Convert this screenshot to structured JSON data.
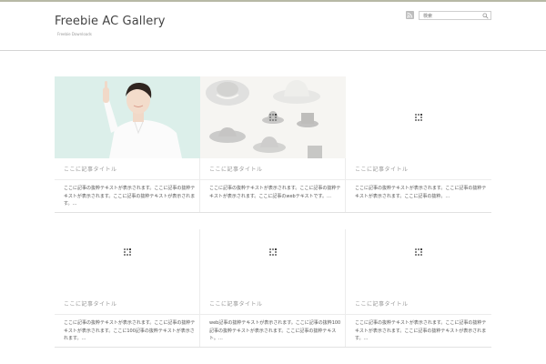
{
  "site": {
    "title": "Freebie AC Gallery",
    "tagline": "Freebie Downloads"
  },
  "search": {
    "placeholder": "検索"
  },
  "icons": {
    "rss": "rss-icon",
    "search": "search-icon",
    "loading": "loading-icon"
  },
  "colors": {
    "nurse_bg": "#cfe7e2",
    "hats_bg": "#f1f0eb",
    "title_gray": "#999999"
  },
  "posts": [
    {
      "title": "ここに記事タイトル",
      "excerpt": "ここに記事の抜粋テキストが表示されます。ここに記事の抜粋テキストが表示されます。ここに記事の抜粋テキストが表示されます。…"
    },
    {
      "title": "ここに記事タイトル",
      "excerpt": "ここに記事の抜粋テキストが表示されます。ここに記事の抜粋テキストが表示されます。ここに記事のwebテキストです。…"
    },
    {
      "title": "ここに記事タイトル",
      "excerpt": "ここに記事の抜粋テキストが表示されます。ここに記事の抜粋テキストが表示されます。ここに記事の抜粋。…"
    },
    {
      "title": "ここに記事タイトル",
      "excerpt": "ここに記事の抜粋テキストが表示されます。ここに記事の抜粋テキストが表示されます。ここに100記事の抜粋テキストが表示されます。…"
    },
    {
      "title": "ここに記事タイトル",
      "excerpt": "web記事の抜粋テキストが表示されます。ここに記事の抜粋100記事の抜粋テキストが表示されます。ここに記事の抜粋テキスト。…"
    },
    {
      "title": "ここに記事タイトル",
      "excerpt": "ここに記事の抜粋テキストが表示されます。ここに記事の抜粋テキストが表示されます。ここに記事の抜粋テキストが表示されます。…"
    }
  ]
}
